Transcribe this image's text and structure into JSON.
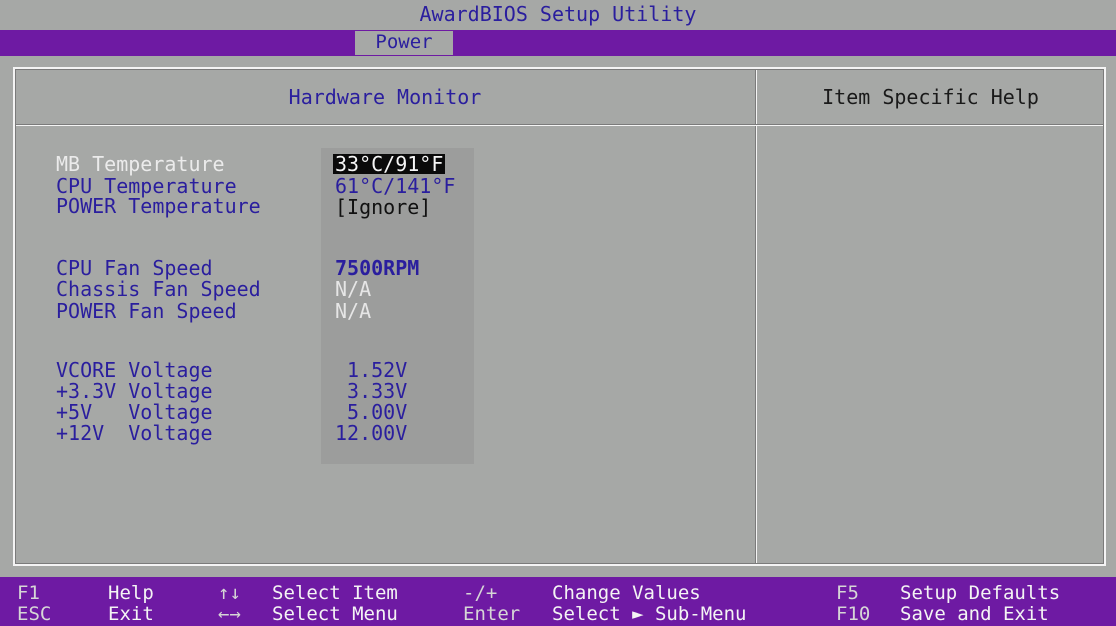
{
  "window": {
    "title": "AwardBIOS Setup Utility"
  },
  "menu": {
    "active_tab": "Power"
  },
  "section": {
    "title": "Hardware Monitor",
    "help_title": "Item Specific Help"
  },
  "items": [
    {
      "label": "MB Temperature",
      "value": "33°C/91°F",
      "state": "selected"
    },
    {
      "label": "CPU Temperature",
      "value": "61°C/141°F",
      "state": "normal"
    },
    {
      "label": "POWER Temperature",
      "value": "[Ignore]",
      "state": "editable"
    },
    {
      "label": "CPU Fan Speed",
      "value": "7500RPM",
      "state": "normal"
    },
    {
      "label": "Chassis Fan Speed",
      "value": "N/A",
      "state": "disabled"
    },
    {
      "label": "POWER Fan Speed",
      "value": "N/A",
      "state": "disabled"
    },
    {
      "label": "VCORE Voltage",
      "value": " 1.52V",
      "state": "normal"
    },
    {
      "label": "+3.3V Voltage",
      "value": " 3.33V",
      "state": "normal"
    },
    {
      "label": "+5V   Voltage",
      "value": " 5.00V",
      "state": "normal"
    },
    {
      "label": "+12V  Voltage",
      "value": "12.00V",
      "state": "normal"
    }
  ],
  "footer": {
    "f1_key": "F1",
    "f1_desc": "Help",
    "esc_key": "ESC",
    "esc_desc": "Exit",
    "updown_key": "↑↓",
    "updown_desc": "Select Item",
    "leftright_key": "←→",
    "leftright_desc": "Select Menu",
    "plusminus_key": "-/+",
    "plusminus_desc": "Change Values",
    "enter_key": "Enter",
    "enter_desc": "Select ► Sub-Menu",
    "f5_key": "F5",
    "f5_desc": "Setup Defaults",
    "f10_key": "F10",
    "f10_desc": "Save and Exit"
  },
  "colors": {
    "background": "#a6a8a6",
    "menu_bar": "#6e1aa3",
    "text_blue": "#2a1e9e",
    "highlight_bg": "#0a0a0a"
  }
}
